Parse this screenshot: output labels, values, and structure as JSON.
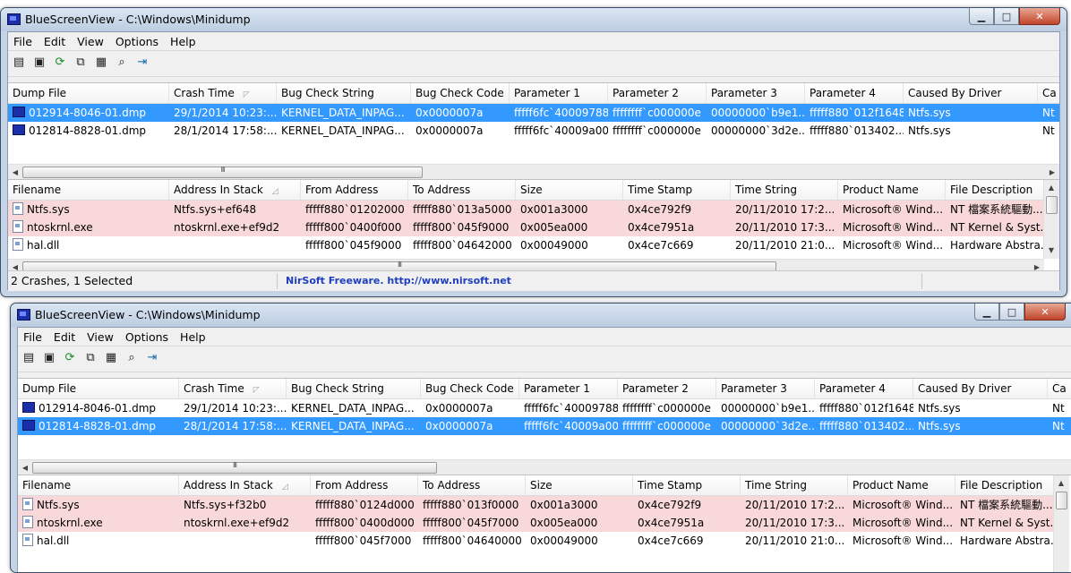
{
  "app": {
    "title": "BlueScreenView  -  C:\\Windows\\Minidump",
    "controls": {
      "minimize": "▁",
      "maximize": "□",
      "close": "✕"
    }
  },
  "menu": [
    "File",
    "Edit",
    "View",
    "Options",
    "Help"
  ],
  "toolbar_icons": [
    "properties-icon",
    "save-icon",
    "refresh-icon",
    "copy-icon",
    "html-report-icon",
    "find-icon",
    "exit-icon"
  ],
  "dump_columns": [
    "Dump File",
    "Crash Time",
    "Bug Check String",
    "Bug Check Code",
    "Parameter 1",
    "Parameter 2",
    "Parameter 3",
    "Parameter 4",
    "Caused By Driver",
    "Ca"
  ],
  "dump_sort_indicator": "◸",
  "driver_columns": [
    "Filename",
    "Address In Stack",
    "From Address",
    "To Address",
    "Size",
    "Time Stamp",
    "Time String",
    "Product Name",
    "File Description"
  ],
  "driver_sort_indicator": "◿",
  "status": {
    "count": "2 Crashes, 1 Selected",
    "credit": "NirSoft Freeware.  http://www.nirsoft.net"
  },
  "scroll_grip": "III",
  "windows": [
    {
      "dumps": [
        [
          "012914-8046-01.dmp",
          "29/1/2014 10:23:...",
          "KERNEL_DATA_INPAG...",
          "0x0000007a",
          "fffff6fc`40009788",
          "ffffffff`c000000e",
          "00000000`b9e1...",
          "fffff880`012f1648",
          "Ntfs.sys",
          "Nt"
        ],
        [
          "012814-8828-01.dmp",
          "28/1/2014 17:58:...",
          "KERNEL_DATA_INPAG...",
          "0x0000007a",
          "fffff6fc`40009a00",
          "ffffffff`c000000e",
          "00000000`3d2e...",
          "fffff880`013402...",
          "Ntfs.sys",
          "Nt"
        ]
      ],
      "selected_dump": 0,
      "drivers": [
        {
          "highlight": true,
          "cells": [
            "Ntfs.sys",
            "Ntfs.sys+ef648",
            "fffff880`01202000",
            "fffff880`013a5000",
            "0x001a3000",
            "0x4ce792f9",
            "20/11/2010 17:2...",
            "Microsoft® Wind...",
            "NT 檔案系統驅動..."
          ]
        },
        {
          "highlight": true,
          "cells": [
            "ntoskrnl.exe",
            "ntoskrnl.exe+ef9d2",
            "fffff800`0400f000",
            "fffff800`045f9000",
            "0x005ea000",
            "0x4ce7951a",
            "20/11/2010 17:3...",
            "Microsoft® Wind...",
            "NT Kernel & Syst..."
          ]
        },
        {
          "highlight": false,
          "cells": [
            "hal.dll",
            "",
            "fffff800`045f9000",
            "fffff800`04642000",
            "0x00049000",
            "0x4ce7c669",
            "20/11/2010 21:0...",
            "Microsoft® Wind...",
            "Hardware Abstra..."
          ]
        }
      ]
    },
    {
      "dumps": [
        [
          "012914-8046-01.dmp",
          "29/1/2014 10:23:...",
          "KERNEL_DATA_INPAG...",
          "0x0000007a",
          "fffff6fc`40009788",
          "ffffffff`c000000e",
          "00000000`b9e1...",
          "fffff880`012f1648",
          "Ntfs.sys",
          "Nt"
        ],
        [
          "012814-8828-01.dmp",
          "28/1/2014 17:58:...",
          "KERNEL_DATA_INPAG...",
          "0x0000007a",
          "fffff6fc`40009a00",
          "ffffffff`c000000e",
          "00000000`3d2e...",
          "fffff880`013402...",
          "Ntfs.sys",
          "Nt"
        ]
      ],
      "selected_dump": 1,
      "drivers": [
        {
          "highlight": true,
          "cells": [
            "Ntfs.sys",
            "Ntfs.sys+f32b0",
            "fffff880`0124d000",
            "fffff880`013f0000",
            "0x001a3000",
            "0x4ce792f9",
            "20/11/2010 17:2...",
            "Microsoft® Wind...",
            "NT 檔案系統驅動..."
          ]
        },
        {
          "highlight": true,
          "cells": [
            "ntoskrnl.exe",
            "ntoskrnl.exe+ef9d2",
            "fffff800`0400d000",
            "fffff800`045f7000",
            "0x005ea000",
            "0x4ce7951a",
            "20/11/2010 17:3...",
            "Microsoft® Wind...",
            "NT Kernel & Syst..."
          ]
        },
        {
          "highlight": false,
          "cells": [
            "hal.dll",
            "",
            "fffff800`045f7000",
            "fffff800`04640000",
            "0x00049000",
            "0x4ce7c669",
            "20/11/2010 21:0...",
            "Microsoft® Wind...",
            "Hardware Abstra..."
          ]
        }
      ]
    }
  ]
}
